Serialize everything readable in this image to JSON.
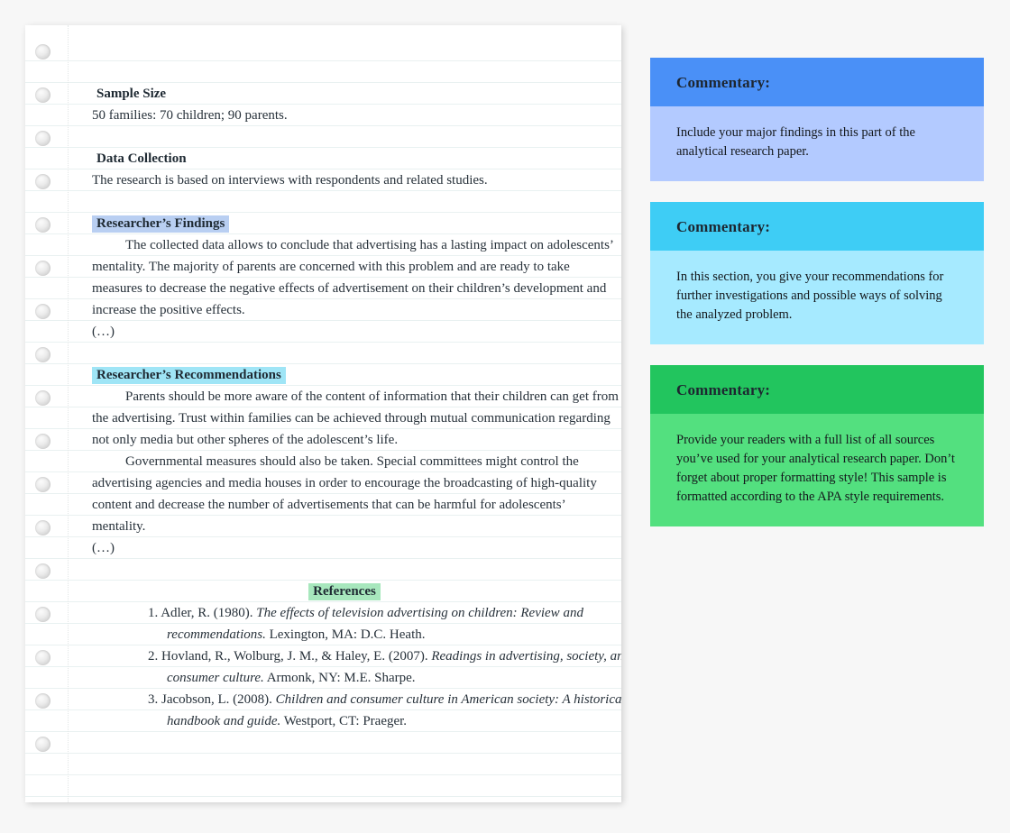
{
  "document": {
    "lines": [
      {
        "kind": "blank",
        "text": ""
      },
      {
        "kind": "blank",
        "text": ""
      },
      {
        "kind": "head",
        "text": "Sample Size",
        "highlight": "none"
      },
      {
        "kind": "body",
        "text": "50 families: 70 children; 90 parents."
      },
      {
        "kind": "blank",
        "text": ""
      },
      {
        "kind": "head",
        "text": "Data Collection",
        "highlight": "none"
      },
      {
        "kind": "body",
        "text": "The research is based on interviews with respondents and related studies."
      },
      {
        "kind": "blank",
        "text": ""
      },
      {
        "kind": "head",
        "text": "Researcher’s Findings",
        "highlight": "blue"
      },
      {
        "kind": "body-indent",
        "text": "The collected data allows to conclude that advertising has a lasting impact on adolescents’"
      },
      {
        "kind": "body",
        "text": "mentality. The majority of parents are concerned with this problem and are ready to take"
      },
      {
        "kind": "body",
        "text": "measures to decrease the negative effects of advertisement on their children’s development and"
      },
      {
        "kind": "body",
        "text": "increase the positive effects."
      },
      {
        "kind": "body",
        "text": "(…)"
      },
      {
        "kind": "blank",
        "text": ""
      },
      {
        "kind": "head",
        "text": "Researcher’s Recommendations",
        "highlight": "cyan"
      },
      {
        "kind": "body-indent",
        "text": "Parents should be more aware of the content of information that their children can get from"
      },
      {
        "kind": "body",
        "text": "the advertising. Trust within families can be achieved through mutual communication regarding"
      },
      {
        "kind": "body",
        "text": "not only media but other spheres of the adolescent’s life."
      },
      {
        "kind": "body-indent",
        "text": "Governmental measures should also be taken. Special committees might control the"
      },
      {
        "kind": "body",
        "text": "advertising agencies and media houses in order to encourage the broadcasting of high-quality"
      },
      {
        "kind": "body",
        "text": "content and decrease the number of advertisements that can be harmful for adolescents’"
      },
      {
        "kind": "body",
        "text": "mentality."
      },
      {
        "kind": "body",
        "text": "(…)"
      },
      {
        "kind": "blank",
        "text": ""
      }
    ],
    "references_heading": "References",
    "references": [
      {
        "number": "1.",
        "line1_plain": "Adler, R. (1980). ",
        "line1_italic": "The effects of television advertising on children: Review and",
        "line2_italic": "recommendations.",
        "line2_plain": " Lexington, MA: D.C. Heath."
      },
      {
        "number": "2.",
        "line1_plain": "Hovland, R., Wolburg, J. M., & Haley, E. (2007). ",
        "line1_italic": "Readings in advertising, society, and",
        "line2_italic": "consumer culture.",
        "line2_plain": " Armonk, NY: M.E. Sharpe."
      },
      {
        "number": "3.",
        "line1_plain": "Jacobson, L. (2008). ",
        "line1_italic": "Children and consumer culture in American society: A historical",
        "line2_italic": "handbook and guide.",
        "line2_plain": " Westport, CT: Praeger."
      }
    ]
  },
  "commentaries": [
    {
      "id": "commentary-findings",
      "heading": "Commentary:",
      "body": "Include your major findings in this part of the analytical research paper.",
      "header_color": "#4a90f7",
      "body_color": "#b3caff"
    },
    {
      "id": "commentary-recommendations",
      "heading": "Commentary:",
      "body": "In this section, you give your recommendations for further investigations and possible ways of solving the analyzed problem.",
      "header_color": "#3ecdf5",
      "body_color": "#a6eaff"
    },
    {
      "id": "commentary-references",
      "heading": "Commentary:",
      "body": "Provide your readers with a full list of all sources you’ve used for your analytical research paper. Don’t forget about proper formatting style! This sample is formatted according to the APA style requirements.",
      "header_color": "#22c55e",
      "body_color": "#53e07f"
    }
  ],
  "highlight_colors": {
    "findings": "#b9cff2",
    "recommendations": "#9fe5f6",
    "references": "#a7e7bd"
  }
}
